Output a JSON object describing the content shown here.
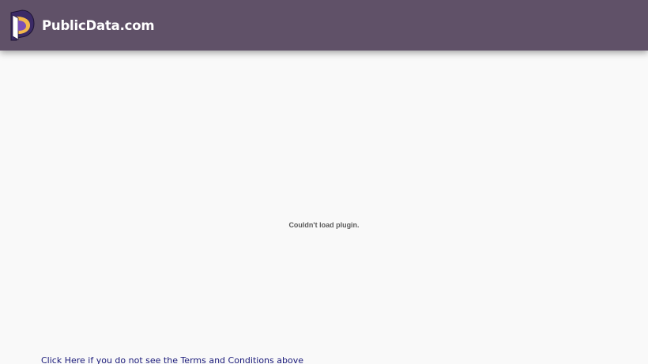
{
  "header": {
    "logo_icon": "publicdata-logo-icon",
    "brand_name": "PublicData.com",
    "background_color": "#605168"
  },
  "plugin": {
    "message": "Couldn't load plugin."
  },
  "footer": {
    "terms_link_text": "Click Here if you do not see the Terms and Conditions above",
    "link_color": "#1a1a7a"
  }
}
